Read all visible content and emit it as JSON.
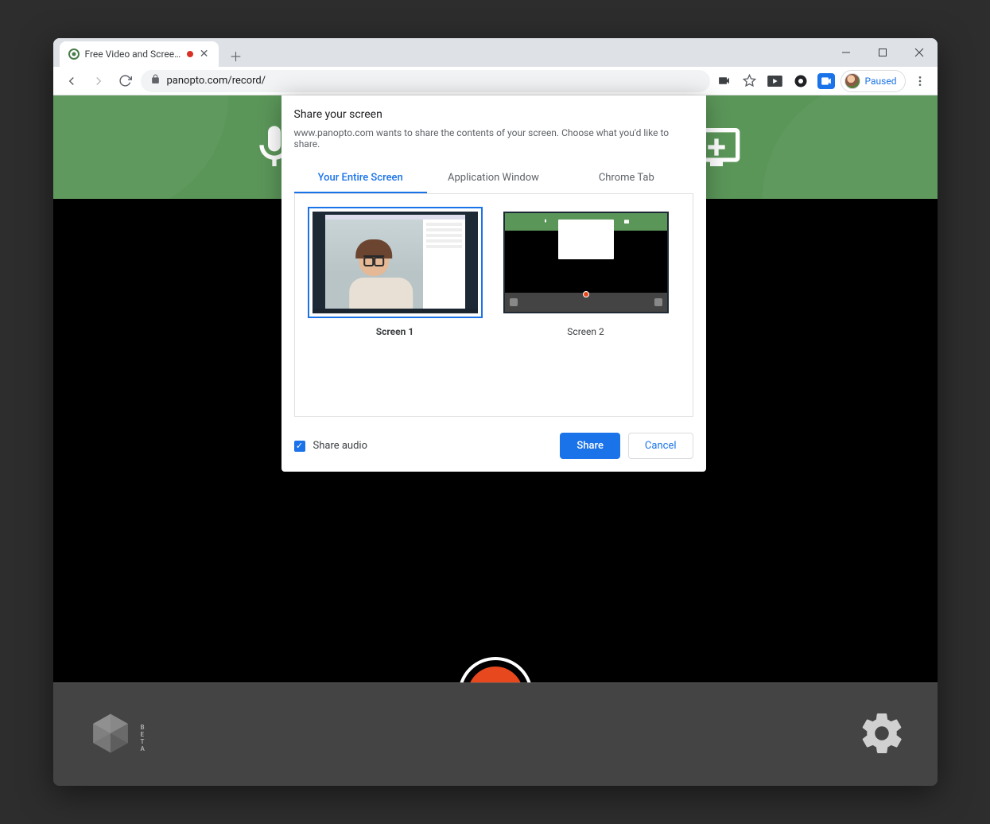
{
  "browser": {
    "tab_title": "Free Video and Screen Reco",
    "url": "panopto.com/record/",
    "profile_status": "Paused"
  },
  "share_dialog": {
    "title": "Share your screen",
    "description": "www.panopto.com wants to share the contents of your screen. Choose what you'd like to share.",
    "tabs": {
      "entire": "Your Entire Screen",
      "window": "Application Window",
      "chrome": "Chrome Tab"
    },
    "screens": {
      "s1": "Screen 1",
      "s2": "Screen 2"
    },
    "share_audio_label": "Share audio",
    "share_button": "Share",
    "cancel_button": "Cancel"
  },
  "bottom_bar": {
    "beta_tag": "B\nE\nT\nA"
  },
  "colors": {
    "accent_green": "#5b9659",
    "accent_blue": "#1a73e8",
    "record_red": "#e8481d"
  }
}
